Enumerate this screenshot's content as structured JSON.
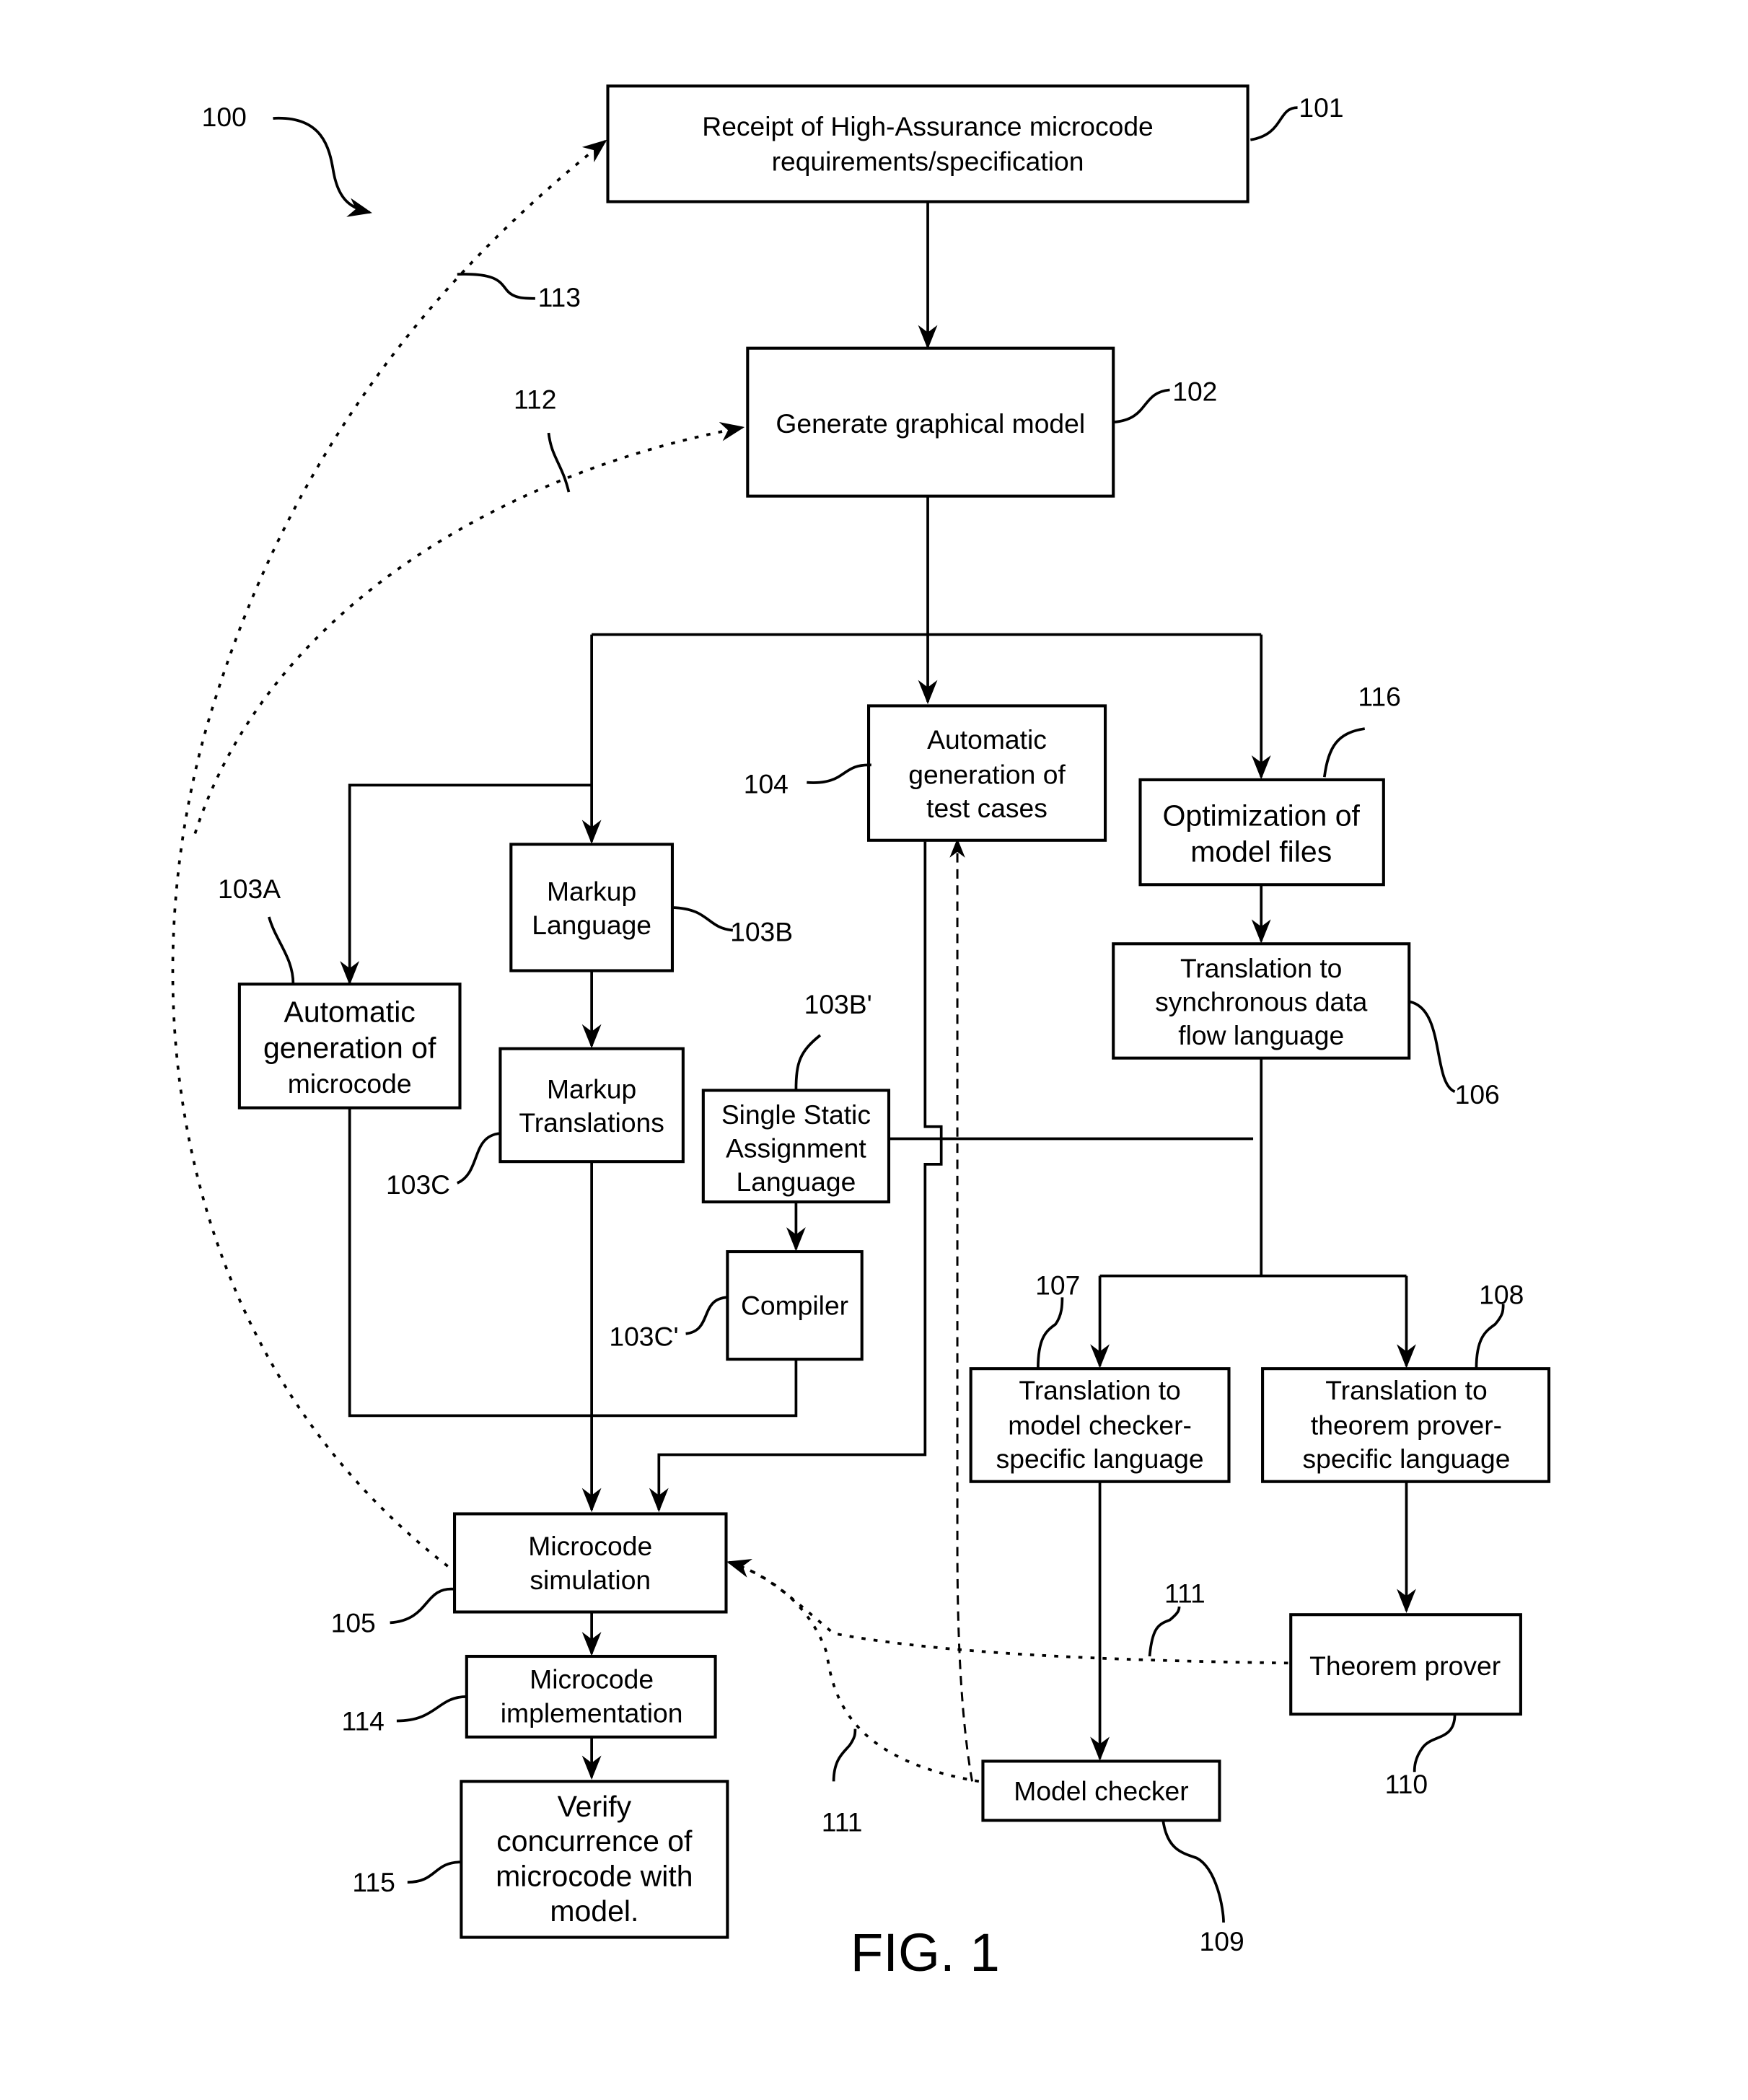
{
  "figure": {
    "number": "100",
    "caption": "FIG. 1"
  },
  "boxes": {
    "b101": {
      "ref": "101",
      "lines": [
        "Receipt of High-Assurance microcode",
        "requirements/specification"
      ]
    },
    "b102": {
      "ref": "102",
      "lines": [
        "Generate graphical model"
      ]
    },
    "b104": {
      "ref": "104",
      "lines": [
        "Automatic",
        "generation of",
        "test cases"
      ]
    },
    "b116": {
      "ref": "116",
      "lines": [
        "Optimization of",
        "model files"
      ]
    },
    "b103a": {
      "ref": "103A",
      "lines": [
        "Automatic",
        "generation of",
        "microcode"
      ]
    },
    "b103b": {
      "ref": "103B",
      "lines": [
        "Markup",
        "Language"
      ]
    },
    "b103c": {
      "ref": "103C",
      "lines": [
        "Markup",
        "Translations"
      ]
    },
    "b103bp": {
      "ref": "103B'",
      "lines": [
        "Single Static",
        "Assignment",
        "Language"
      ]
    },
    "b103cp": {
      "ref": "103C'",
      "lines": [
        "Compiler"
      ]
    },
    "b106": {
      "ref": "106",
      "lines": [
        "Translation to",
        "synchronous data",
        "flow language"
      ]
    },
    "b107": {
      "ref": "107",
      "lines": [
        "Translation to",
        "model checker-",
        "specific language"
      ]
    },
    "b108": {
      "ref": "108",
      "lines": [
        "Translation to",
        "theorem prover-",
        "specific language"
      ]
    },
    "b105": {
      "ref": "105",
      "lines": [
        "Microcode",
        "simulation"
      ]
    },
    "b114": {
      "ref": "114",
      "lines": [
        "Microcode",
        "implementation"
      ]
    },
    "b115": {
      "ref": "115",
      "lines": [
        "Verify",
        "concurrence of",
        "microcode with",
        "model."
      ]
    },
    "b109": {
      "ref": "109",
      "lines": [
        "Model checker"
      ]
    },
    "b110": {
      "ref": "110",
      "lines": [
        "Theorem prover"
      ]
    }
  },
  "feedback": {
    "r111a": "111",
    "r111b": "111",
    "r112": "112",
    "r113": "113"
  }
}
